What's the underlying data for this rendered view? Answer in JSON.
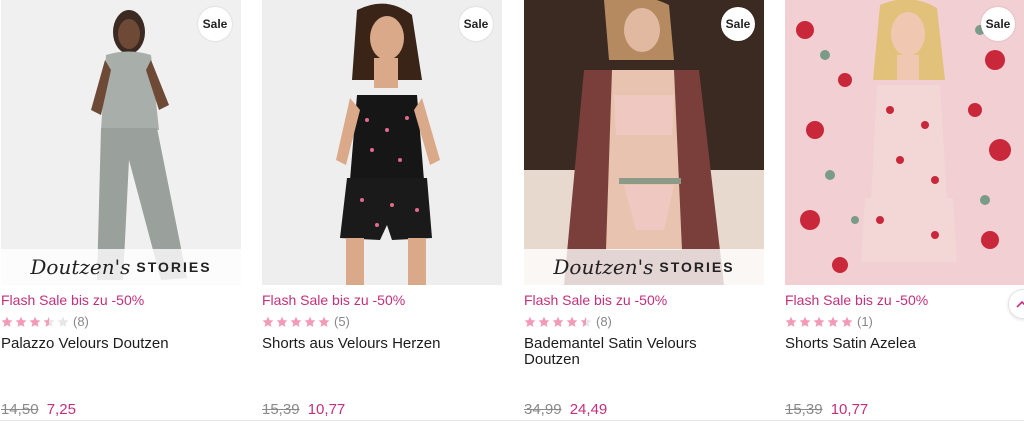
{
  "colors": {
    "accent": "#c2307c",
    "star_filled": "#f29bb8",
    "star_empty": "#e7e7e7",
    "muted": "#8a8a8a"
  },
  "products": [
    {
      "badge": "Sale",
      "overlay": {
        "script": "Doutzen's",
        "caps": "STORIES"
      },
      "flash": "Flash Sale bis zu -50%",
      "rating": 3.5,
      "reviews": "(8)",
      "name": "Palazzo Velours Doutzen",
      "old_price": "14,50",
      "new_price": "7,25"
    },
    {
      "badge": "Sale",
      "overlay": null,
      "flash": "Flash Sale bis zu -50%",
      "rating": 5,
      "reviews": "(5)",
      "name": "Shorts aus Velours Herzen",
      "old_price": "15,39",
      "new_price": "10,77"
    },
    {
      "badge": "Sale",
      "overlay": {
        "script": "Doutzen's",
        "caps": "STORIES"
      },
      "flash": "Flash Sale bis zu -50%",
      "rating": 4.5,
      "reviews": "(8)",
      "name": "Bademantel Satin Velours Doutzen",
      "old_price": "34,99",
      "new_price": "24,49"
    },
    {
      "badge": "Sale",
      "overlay": null,
      "flash": "Flash Sale bis zu -50%",
      "rating": 5,
      "reviews": "(1)",
      "name": "Shorts Satin Azelea",
      "old_price": "15,39",
      "new_price": "10,77"
    }
  ],
  "scroll_up_icon": "chevron-up-icon"
}
